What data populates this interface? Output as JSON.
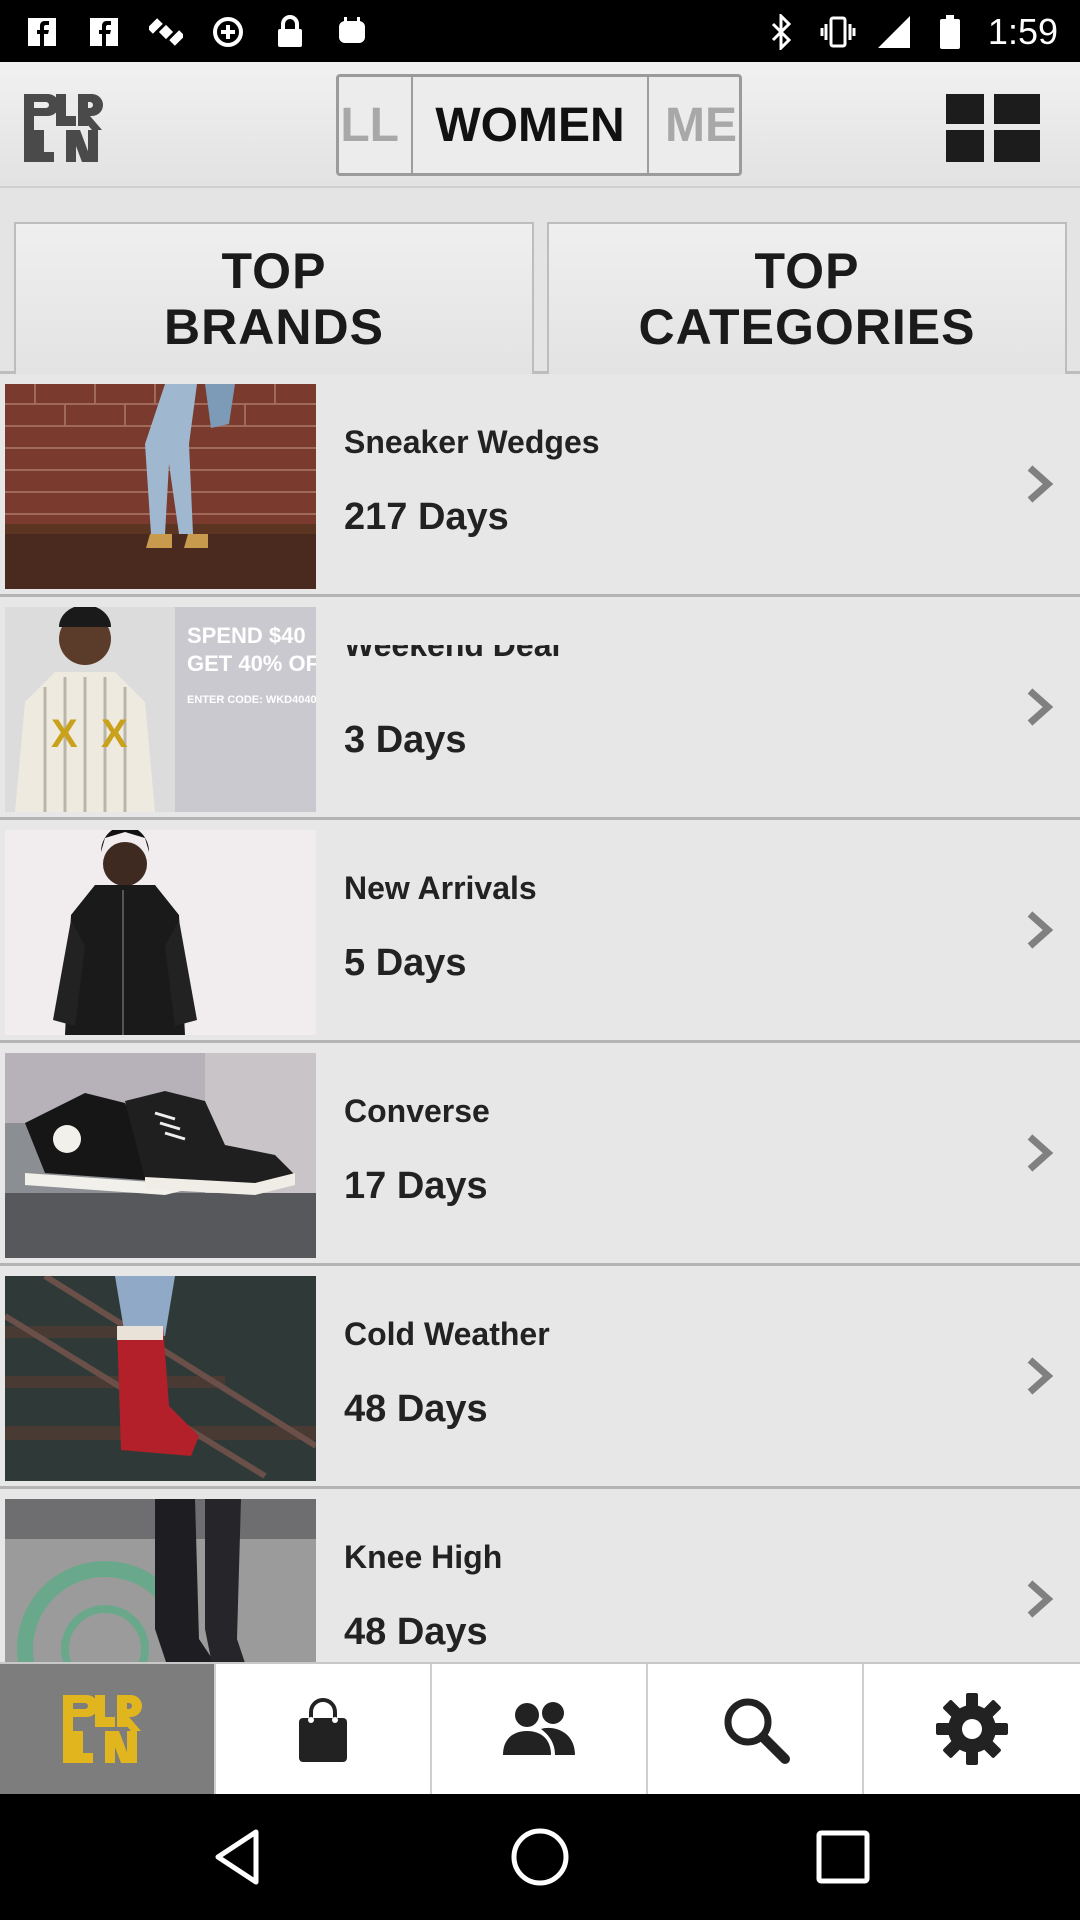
{
  "status_bar": {
    "time": "1:59",
    "left_icons": [
      "facebook-icon",
      "facebook-icon",
      "satellite-icon",
      "data-saver-icon",
      "lock-icon",
      "android-debug-icon"
    ],
    "right_icons": [
      "bluetooth-icon",
      "vibrate-icon",
      "signal-icon",
      "battery-icon"
    ]
  },
  "header": {
    "logo": "PLNR",
    "tabs": [
      {
        "label": "LL",
        "selected": false
      },
      {
        "label": "WOMEN",
        "selected": true
      },
      {
        "label": "ME",
        "selected": false
      }
    ],
    "grid_icon": "grid-view-icon"
  },
  "top_sections": {
    "brands_label": "TOP\nBRANDS",
    "categories_label": "TOP\nCATEGORIES"
  },
  "list": {
    "items": [
      {
        "title": "Sneaker Wedges",
        "days": "217 Days",
        "image": "woman-in-jeans-and-boots-photo"
      },
      {
        "title": "Weekend Deal",
        "days": "3 Days",
        "image": "hoodie-promo-photo",
        "promo_line1": "SPEND $40",
        "promo_line2": "GET 40% OF",
        "promo_code": "ENTER CODE: WKD4040"
      },
      {
        "title": "New Arrivals",
        "days": "5 Days",
        "image": "black-hoodie-model-photo"
      },
      {
        "title": "Converse",
        "days": "17 Days",
        "image": "converse-sneakers-photo"
      },
      {
        "title": "Cold Weather",
        "days": "48 Days",
        "image": "red-boots-photo"
      },
      {
        "title": "Knee High",
        "days": "48 Days",
        "image": "knee-high-boots-photo"
      }
    ]
  },
  "bottom_tabs": [
    "home-logo",
    "shopping-bag-icon",
    "people-icon",
    "search-icon",
    "settings-gear-icon"
  ],
  "colors": {
    "logo_yellow": "#e0b51e",
    "background": "#e6e6e6",
    "text": "#222222"
  }
}
